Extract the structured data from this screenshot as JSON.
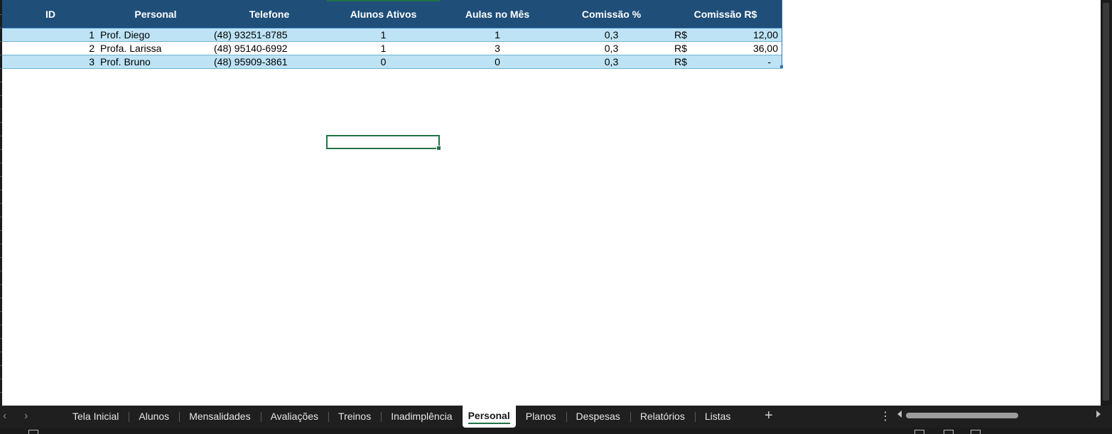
{
  "table": {
    "headers": [
      "ID",
      "Personal",
      "Telefone",
      "Alunos Ativos",
      "Aulas no Mês",
      "Comissão %",
      "Comissão R$"
    ],
    "rows": [
      {
        "id": "1",
        "personal": "Prof. Diego",
        "telefone": "(48) 93251-8785",
        "alunos": "1",
        "aulas": "1",
        "comissao_pct": "0,3",
        "currency": "R$",
        "comissao_valor": "12,00"
      },
      {
        "id": "2",
        "personal": "Profa. Larissa",
        "telefone": "(48) 95140-6992",
        "alunos": "1",
        "aulas": "3",
        "comissao_pct": "0,3",
        "currency": "R$",
        "comissao_valor": "36,00"
      },
      {
        "id": "3",
        "personal": "Prof. Bruno",
        "telefone": "(48) 95909-3861",
        "alunos": "0",
        "aulas": "0",
        "comissao_pct": "0,3",
        "currency": "R$",
        "comissao_valor": "-"
      }
    ]
  },
  "sheet_tabs": {
    "items": [
      "Tela Inicial",
      "Alunos",
      "Mensalidades",
      "Avaliações",
      "Treinos",
      "Inadimplência",
      "Personal",
      "Planos",
      "Despesas",
      "Relatórios",
      "Listas"
    ],
    "active": "Personal"
  },
  "icons": {
    "prev": "chevron-left-icon",
    "next": "chevron-right-icon",
    "add": "plus-icon",
    "more": "more-vertical-icon"
  },
  "colors": {
    "header_bg": "#1f4e79",
    "band": "#bde3f5",
    "selection": "#217346"
  }
}
